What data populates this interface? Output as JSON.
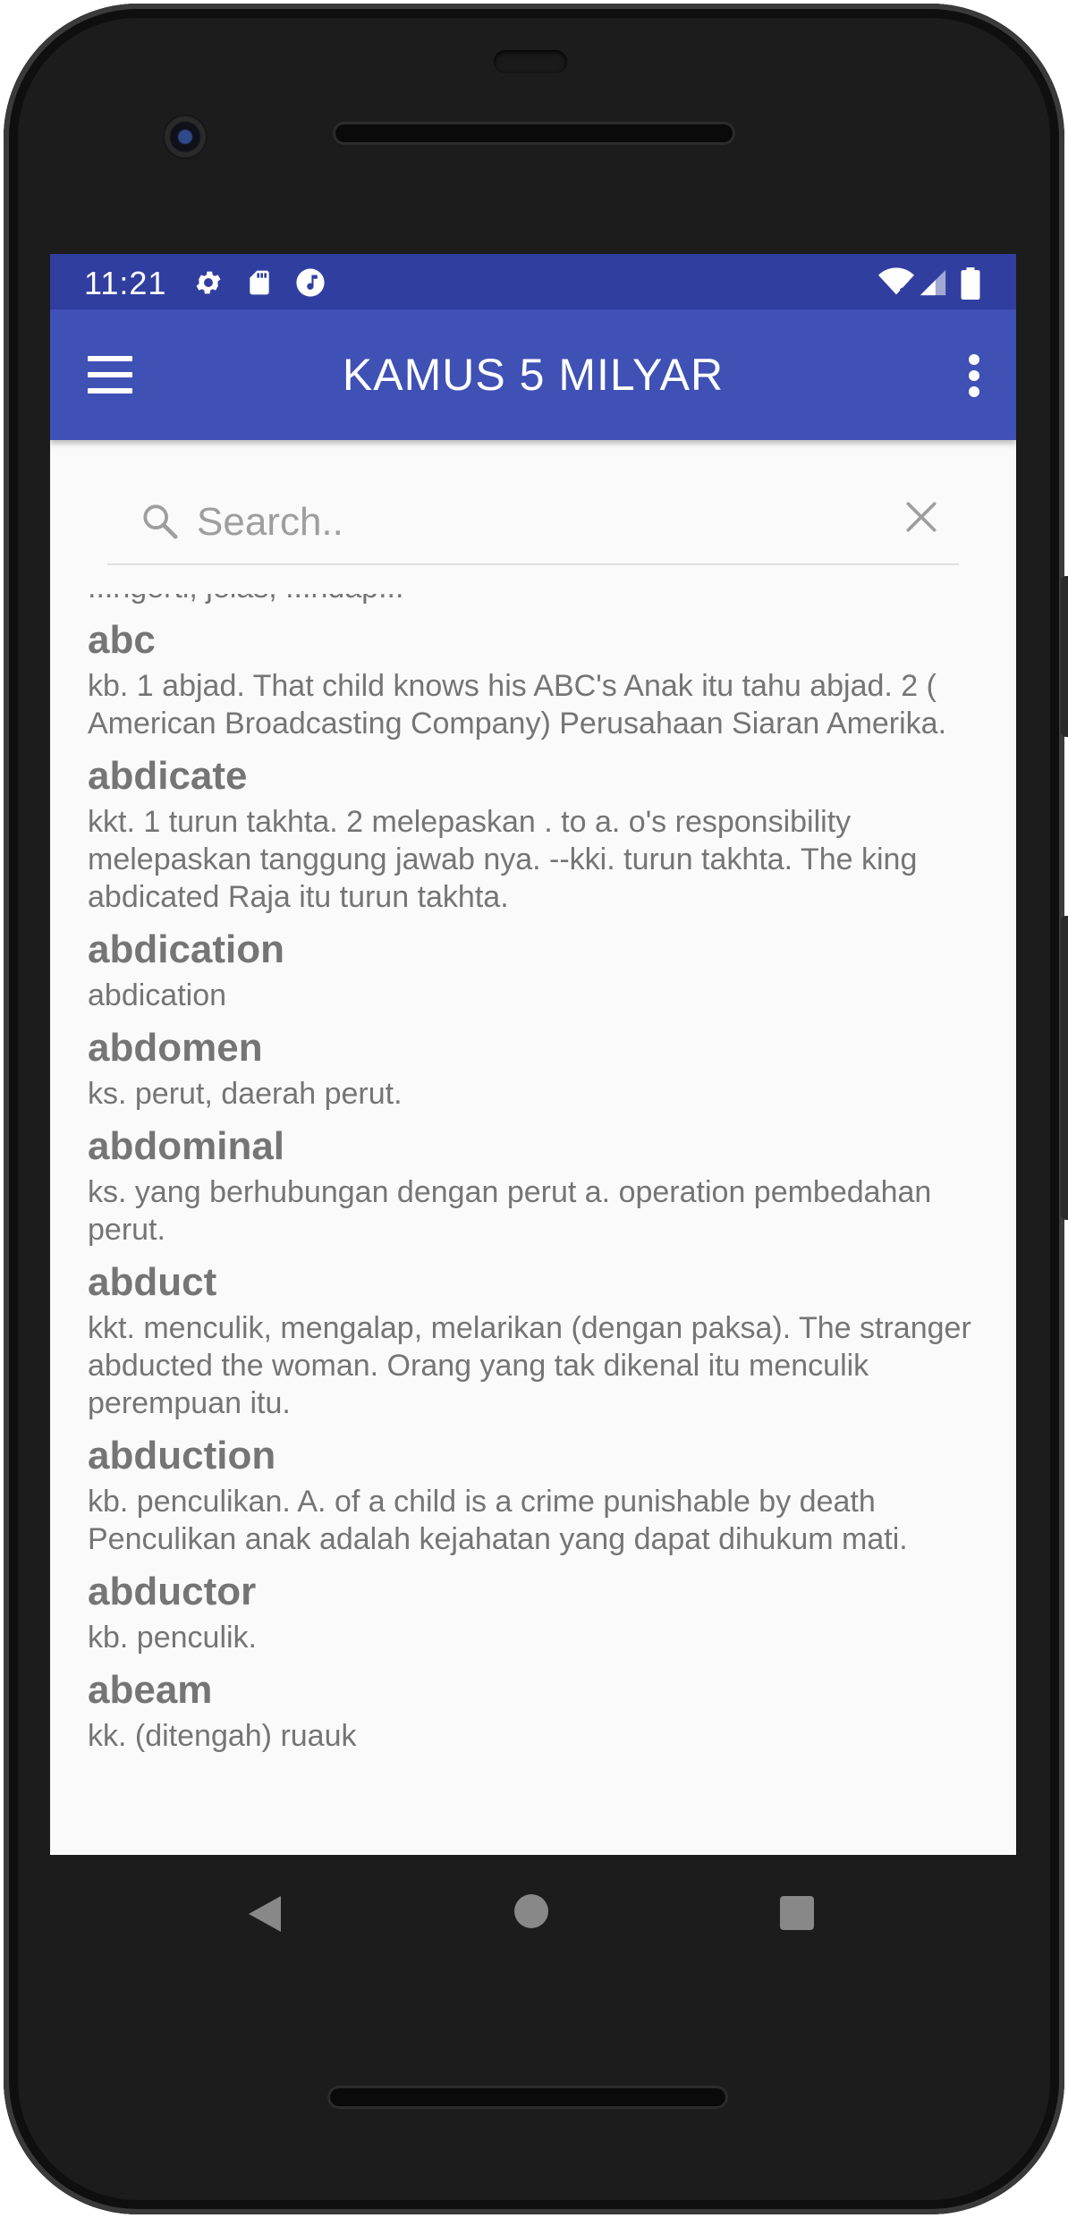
{
  "status_bar": {
    "time": "11:21",
    "left_icons": [
      "gear-icon",
      "sd-card-icon",
      "music-icon"
    ],
    "right_icons": [
      "wifi-icon",
      "signal-icon",
      "battery-icon"
    ]
  },
  "app_bar": {
    "title": "KAMUS 5 MILYAR",
    "menu_icon": "hamburger-menu-icon",
    "overflow_icon": "more-vert-icon"
  },
  "search": {
    "placeholder": "Search..",
    "value": ""
  },
  "entries": [
    {
      "word": "",
      "definition": "...ngerti, jelas, ...ndap..."
    },
    {
      "word": "abc",
      "definition": "kb. 1 abjad. That child knows his ABC's   Anak itu tahu abjad. 2 ( American Broadcasting Company) Perusahaan Siaran Amerika."
    },
    {
      "word": "abdicate",
      "definition": "kkt. 1 turun takhta. 2 melepaskan . to a. o's responsibility melepaskan tanggung jawab nya. --kki. turun takhta. The king abdicated Raja  itu turun  takhta."
    },
    {
      "word": "abdication",
      "definition": "abdication"
    },
    {
      "word": "abdomen",
      "definition": "ks. perut, daerah perut."
    },
    {
      "word": "abdominal",
      "definition": "ks. yang berhubungan dengan perut  a. operation pembedahan perut."
    },
    {
      "word": "abduct",
      "definition": "kkt. menculik, mengalap, melarikan (dengan paksa). The stranger abducted the woman. Orang yang tak dikenal itu menculik perempuan itu."
    },
    {
      "word": "abduction",
      "definition": "kb. penculikan. A. of  a child is a crime punishable by death Penculikan anak adalah kejahatan yang dapat dihukum mati."
    },
    {
      "word": "abductor",
      "definition": "kb. penculik."
    },
    {
      "word": "abeam",
      "definition": "kk. (ditengah) ruauk"
    }
  ],
  "nav_bar": {
    "back_icon": "back-triangle-icon",
    "home_icon": "home-circle-icon",
    "recents_icon": "recents-square-icon"
  }
}
